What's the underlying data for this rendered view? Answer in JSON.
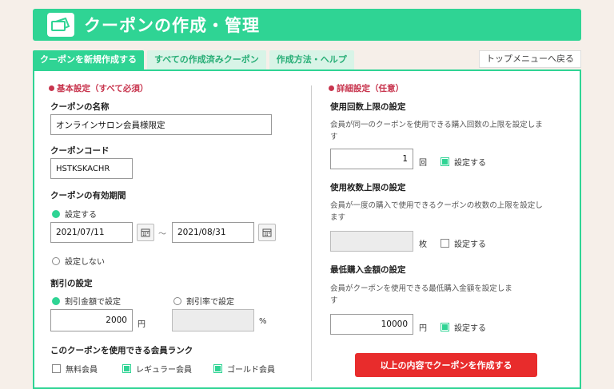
{
  "header": {
    "title": "クーポンの作成・管理"
  },
  "tabs": [
    {
      "label": "クーポンを新規作成する"
    },
    {
      "label": "すべての作成済みクーポン"
    },
    {
      "label": "作成方法・ヘルプ"
    }
  ],
  "back_label": "トップメニューへ戻る",
  "left": {
    "section_title": "基本設定（すべて必須）",
    "name_label": "クーポンの名称",
    "name_value": "オンラインサロン会員様限定",
    "code_label": "クーポンコード",
    "code_value": "HSTKSKACHR",
    "period_label": "クーポンの有効期間",
    "period_set": "設定する",
    "date_from": "2021/07/11",
    "date_sep": "〜",
    "date_to": "2021/08/31",
    "period_unset": "設定しない",
    "discount_label": "割引の設定",
    "discount_amount_opt": "割引金額で設定",
    "discount_rate_opt": "割引率で設定",
    "discount_amount_value": "2000",
    "unit_yen": "円",
    "unit_percent": "%",
    "rank_label": "このクーポンを使用できる会員ランク",
    "ranks": [
      {
        "label": "無料会員",
        "checked": false
      },
      {
        "label": "レギュラー会員",
        "checked": true
      },
      {
        "label": "ゴールド会員",
        "checked": true
      }
    ]
  },
  "right": {
    "section_title": "詳細設定（任意）",
    "use_limit_label": "使用回数上限の設定",
    "use_limit_desc": "会員が同一のクーポンを使用できる購入回数の上限を設定します",
    "use_limit_value": "1",
    "use_limit_unit": "回",
    "use_limit_check": "設定する",
    "count_limit_label": "使用枚数上限の設定",
    "count_limit_desc": "会員が一度の購入で使用できるクーポンの枚数の上限を設定します",
    "count_limit_value": "",
    "count_limit_unit": "枚",
    "count_limit_check": "設定する",
    "min_amount_label": "最低購入金額の設定",
    "min_amount_desc": "会員がクーポンを使用できる最低購入金額を設定します",
    "min_amount_value": "10000",
    "min_amount_unit": "円",
    "min_amount_check": "設定する",
    "submit_label": "以上の内容でクーポンを作成する"
  },
  "colors": {
    "accent": "#2fd494",
    "danger": "#e82c2c",
    "section": "#c8354e"
  }
}
